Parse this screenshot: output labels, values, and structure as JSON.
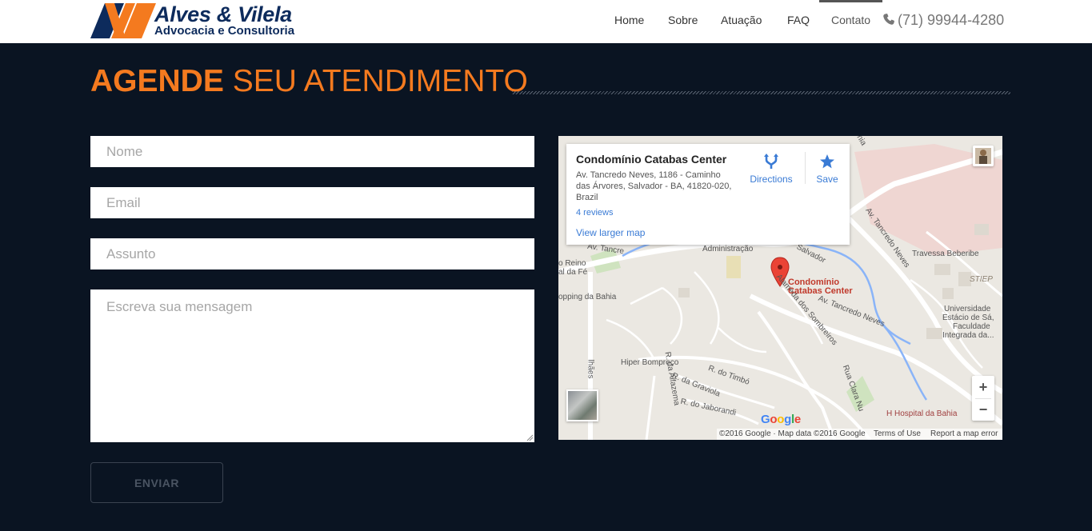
{
  "brand": {
    "title": "Alves & Vilela",
    "subtitle": "Advocacia e Consultoria",
    "colors": {
      "navy": "#0d2b5c",
      "orange": "#f47a1f"
    }
  },
  "nav": {
    "items": [
      "Home",
      "Sobre",
      "Atuação",
      "FAQ",
      "Contato"
    ],
    "active": "Contato",
    "phone": "(71) 99944-4280",
    "phone_icon": "phone-icon"
  },
  "heading": {
    "strong": "AGENDE",
    "light": "SEU ATENDIMENTO",
    "color": "#f47a1f"
  },
  "form": {
    "name_placeholder": "Nome",
    "email_placeholder": "Email",
    "subject_placeholder": "Assunto",
    "message_placeholder": "Escreva sua mensagem",
    "submit_label": "ENVIAR"
  },
  "map": {
    "info": {
      "title": "Condomínio Catabas Center",
      "address": "Av. Tancredo Neves, 1186 - Caminho das Árvores, Salvador - BA, 41820-020, Brazil",
      "reviews": "4 reviews",
      "larger_map": "View larger map",
      "directions": "Directions",
      "save": "Save"
    },
    "marker_label_line1": "Condomínio",
    "marker_label_line2": "Catabas Center",
    "labels": {
      "administracao": "Administração",
      "av_tancredo_top": "Av. Tancre",
      "salvador": "Salvador",
      "av_tancredo_neves_right": "Av. Tancredo Neves",
      "travessa": "Travessa Beberibe",
      "stiep": "STIEP",
      "universidade": "Universidade",
      "estacio": "Estácio de Sá,",
      "faculdade": "Faculdade",
      "integrada": "Integrada da...",
      "reino": "o Reino",
      "fe": "al da Fé",
      "shopping": "opping da Bahia",
      "alameda": "Alameda dos Sombreiros",
      "av_tancredo_neves_mid": "Av. Tancredo Neves",
      "hiper": "Hiper Bompreço",
      "timbo": "R. do Timbó",
      "graviola": "R. da Graviola",
      "jaborandi": "R. do Jaborandi",
      "alfazema": "R. da Alfazema",
      "clara": "Rua Clara Nu",
      "hospital": "Hospital da Bahia",
      "lhaes": "lhães",
      "catabas_road": "Catabas",
      "nia": "nia"
    },
    "google": "Google",
    "footer": {
      "copyright": "©2016 Google · Map data ©2016 Google",
      "terms": "Terms of Use",
      "report": "Report a map error"
    },
    "zoom_in": "+",
    "zoom_out": "−"
  }
}
